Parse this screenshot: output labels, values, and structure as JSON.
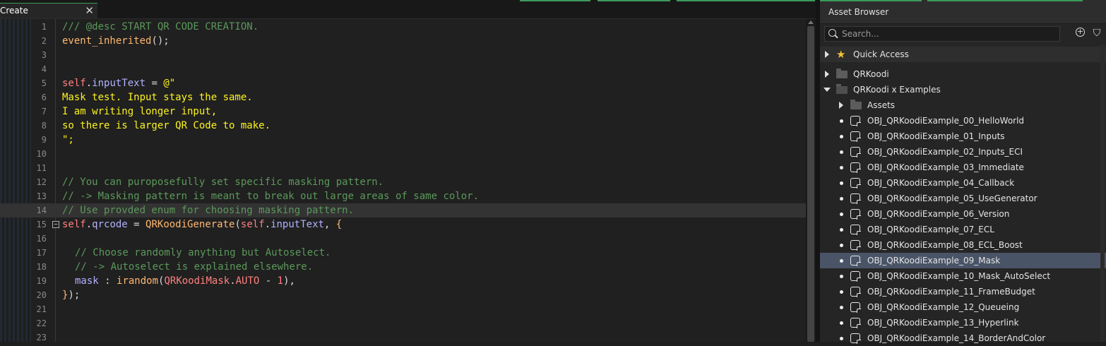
{
  "editor": {
    "tab_label": "Create",
    "tab_close": "✕",
    "line_numbers": [
      "1",
      "2",
      "3",
      "4",
      "5",
      "6",
      "7",
      "8",
      "9",
      "10",
      "11",
      "12",
      "13",
      "14",
      "15",
      "16",
      "17",
      "18",
      "19",
      "20",
      "21",
      "22",
      "23"
    ],
    "lines": {
      "l1": "/// @desc START QR CODE CREATION.",
      "l2_fn": "event_inherited",
      "l2_rest": "();",
      "l5_self": "self",
      "l5_dot": ".",
      "l5_var": "inputText",
      "l5_eq": " = ",
      "l5_str": "@\"",
      "l6": "Mask test. Input stays the same.",
      "l7": "I am writing longer input,",
      "l8": "so there is larger QR Code to make.",
      "l9": "\";",
      "l12": "// You can puroposefully set specific masking pattern.",
      "l13": "// -> Masking pattern is meant to break out large areas of same color.",
      "l14": "// Use provded enum for choosing masking pattern.",
      "l15_self": "self",
      "l15_dot": ".",
      "l15_var": "qrcode",
      "l15_eq": " = ",
      "l15_fn": "QRKoodiGenerate",
      "l15_paren": "(",
      "l15_self2": "self",
      "l15_dot2": ".",
      "l15_var2": "inputText",
      "l15_comma": ", ",
      "l15_brace": "{",
      "l17": "// Choose randomly anything but Autoselect.",
      "l18": "// -> Autoselect is explained elsewhere.",
      "l19_key": "mask",
      "l19_colon": " : ",
      "l19_fn": "irandom",
      "l19_paren": "(",
      "l19_enum": "QRKoodiMask",
      "l19_dot": ".",
      "l19_member": "AUTO",
      "l19_minus": " - ",
      "l19_num": "1",
      "l19_close": "),",
      "l20_brace": "}",
      "l20_rest": ");"
    }
  },
  "asset_browser": {
    "title": "Asset Browser",
    "search_placeholder": "Search...",
    "add_icon": "+",
    "filter_icon": "⛉",
    "quick_access": "Quick Access",
    "groups": [
      {
        "label": "QRKoodi",
        "expanded": false
      },
      {
        "label": "QRKoodi x Examples",
        "expanded": true
      }
    ],
    "assets_folder": "Assets",
    "items": [
      "OBJ_QRKoodiExample_00_HelloWorld",
      "OBJ_QRKoodiExample_01_Inputs",
      "OBJ_QRKoodiExample_02_Inputs_ECI",
      "OBJ_QRKoodiExample_03_Immediate",
      "OBJ_QRKoodiExample_04_Callback",
      "OBJ_QRKoodiExample_05_UseGenerator",
      "OBJ_QRKoodiExample_06_Version",
      "OBJ_QRKoodiExample_07_ECL",
      "OBJ_QRKoodiExample_08_ECL_Boost",
      "OBJ_QRKoodiExample_09_Mask",
      "OBJ_QRKoodiExample_10_Mask_AutoSelect",
      "OBJ_QRKoodiExample_11_FrameBudget",
      "OBJ_QRKoodiExample_12_Queueing",
      "OBJ_QRKoodiExample_13_Hyperlink",
      "OBJ_QRKoodiExample_14_BorderAndColor"
    ],
    "selected_item": "OBJ_QRKoodiExample_09_Mask"
  },
  "colors": {
    "accent": "#3b9a5b",
    "comment": "#5b995b",
    "self_keyword": "#ff8080",
    "variable": "#b2b1ff",
    "function": "#ffb871",
    "string": "#fcf320",
    "selection": "#4a5467"
  }
}
